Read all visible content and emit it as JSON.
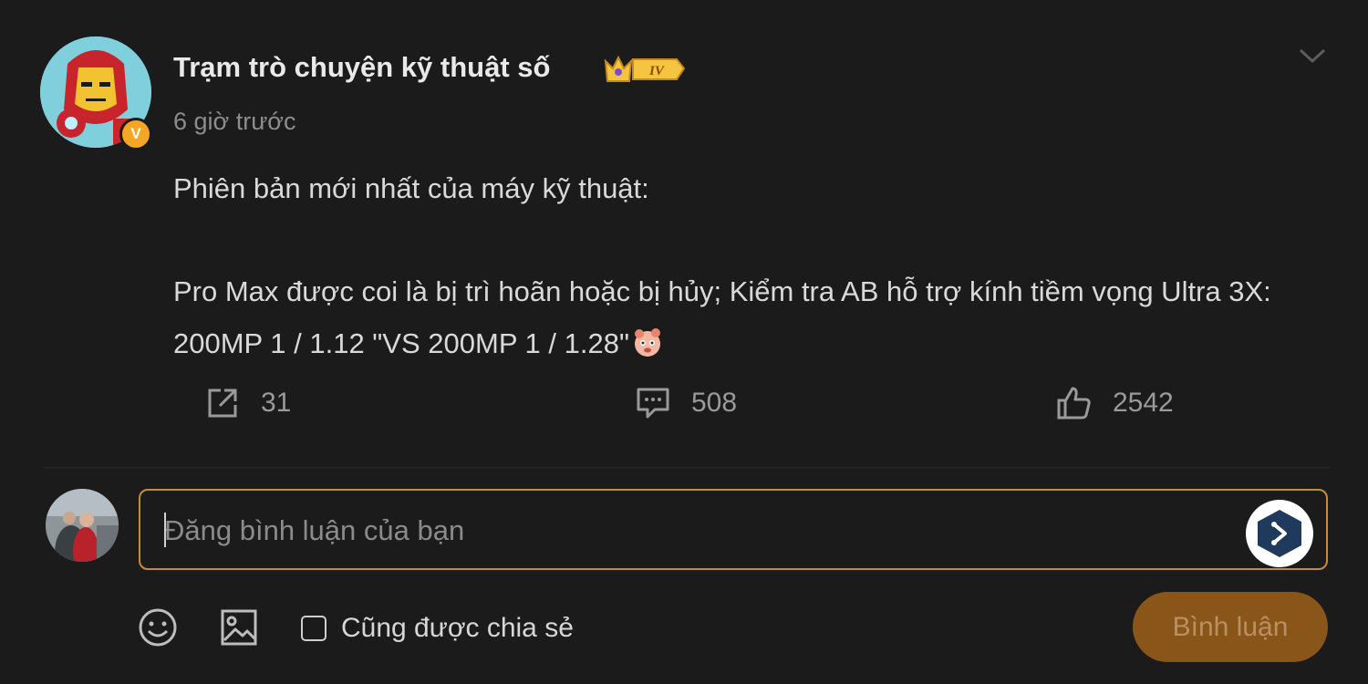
{
  "post": {
    "author": "Trạm trò chuyện kỹ thuật số",
    "level_badge": "IV",
    "verified_mark": "V",
    "timestamp": "6 giờ trước",
    "content_line1": "Phiên bản mới nhất của máy kỹ thuật:",
    "content_line2": " Pro Max được coi là bị trì hoãn hoặc bị hủy; Kiểm tra AB hỗ trợ kính tiềm vọng Ultra 3X: 200MP 1 / 1.12 \"VS 200MP 1 / 1.28\"",
    "stats": {
      "shares": "31",
      "comments": "508",
      "likes": "2542"
    }
  },
  "composer": {
    "placeholder": "Đăng bình luận của bạn",
    "value": "",
    "share_also_label": "Cũng được chia sẻ",
    "share_also_checked": false,
    "submit_label": "Bình luận"
  },
  "icons": {
    "share": "share-icon",
    "comment": "comment-icon",
    "like": "thumbs-up-icon",
    "collapse": "chevron-down-icon",
    "emoji": "emoji-icon",
    "image": "image-icon",
    "plugin": "send-plugin-icon"
  },
  "colors": {
    "background": "#1b1b1b",
    "accent_orange": "#c98a33",
    "submit_bg": "#8a5518",
    "badge_gold": "#f5a623"
  }
}
